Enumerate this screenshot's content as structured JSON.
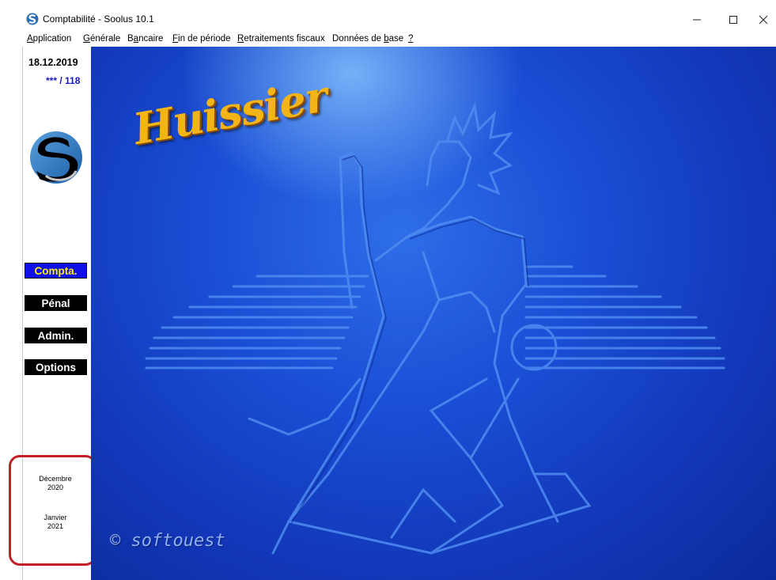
{
  "window": {
    "title": "Comptabilité - Soolus 10.1",
    "minimize_icon": "minimize-icon",
    "maximize_icon": "maximize-icon",
    "close_icon": "close-icon"
  },
  "menu": {
    "application": "pplication",
    "application_key": "A",
    "generale": "énérale",
    "generale_key": "G",
    "bancaire_pre": "B",
    "bancaire_key": "a",
    "bancaire_post": "ncaire",
    "fin_key": "F",
    "fin": "in de période",
    "retraitements_key": "R",
    "retraitements": "etraitements fiscaux",
    "donnees_pre": "Données de ",
    "donnees_key": "b",
    "donnees_post": "ase",
    "help": "?"
  },
  "sidebar": {
    "date": "18.12.2019",
    "counter": "*** / 118",
    "buttons": {
      "compta": "Compta.",
      "penal": "Pénal",
      "admin": "Admin.",
      "options": "Options"
    },
    "months": [
      {
        "month": "Décembre",
        "year": "2020"
      },
      {
        "month": "Janvier",
        "year": "2021"
      }
    ]
  },
  "main": {
    "brand": "Huissier",
    "copyright": "© softouest",
    "power_icon": "power-icon"
  },
  "colors": {
    "accent_blue": "#0f0fe6",
    "active_text": "#ffee00",
    "highlight_red": "#c41e28",
    "background_blue": "#1a4fd6"
  }
}
